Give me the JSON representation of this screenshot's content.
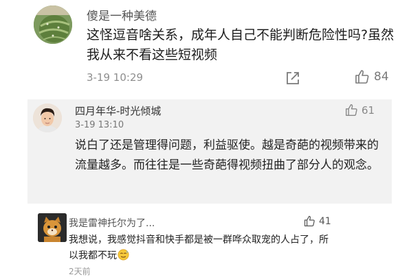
{
  "comments": [
    {
      "username": "傻是一种美德",
      "text": "这怪逗音啥关系，成年人自己不能判断危险性吗?虽然我从来不看这些短视频",
      "time": "3-19 10:29",
      "likes": "84",
      "icons": [
        "avatar-cactus",
        "share-icon",
        "thumbs-up-icon"
      ]
    },
    {
      "username": "四月年华-时光倾城",
      "time": "3-19 13:10",
      "likes": "61",
      "text": "说白了还是管理得问题，利益驱使。越是奇葩的视频带来的流量越多。而往往是一些奇葩得视频扭曲了部分人的观念。",
      "icons": [
        "avatar-person",
        "thumbs-up-icon"
      ]
    },
    {
      "username": "我是雷神托尔为了...",
      "likes": "41",
      "text": "我想说，我感觉抖音和快手都是被一群哗众取宠的人占了，所以我都不玩",
      "time": "2天前",
      "icons": [
        "avatar-cat",
        "thumbs-up-icon",
        "sweat-emoji-icon"
      ]
    }
  ],
  "colors": {
    "highlight_bg": "#f2f2f2",
    "meta_gray": "#8e8e8e"
  }
}
